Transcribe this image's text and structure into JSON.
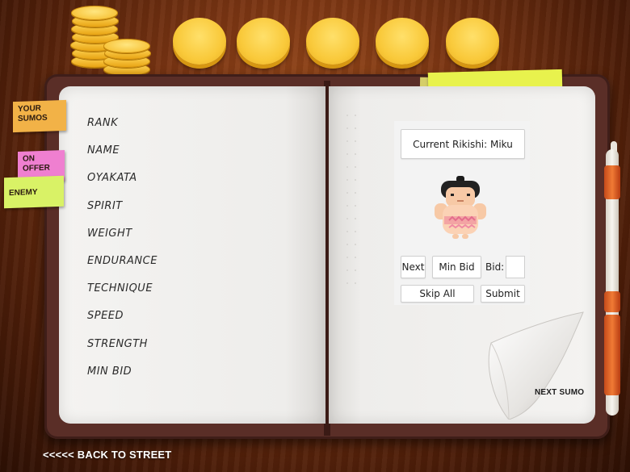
{
  "tabs": {
    "your_sumos": [
      "YOUR",
      "SUMOS"
    ],
    "on_offer": [
      "ON",
      "OFFER"
    ],
    "enemy": "ENEMY"
  },
  "stats": [
    "RANK",
    "NAME",
    "OYAKATA",
    "SPIRIT",
    "WEIGHT",
    "ENDURANCE",
    "TECHNIQUE",
    "SPEED",
    "STRENGTH",
    "MIN BID"
  ],
  "panel": {
    "current": "Current Rikishi: Miku",
    "next": "Next",
    "min_bid": "Min Bid",
    "bid_label": "Bid:",
    "bid_value": "",
    "skip_all": "Skip All",
    "submit": "Submit"
  },
  "next_sumo": "NEXT SUMO",
  "back": "<<<<< BACK TO STREET",
  "icons": {
    "coin_stack": "coin-stack-icon",
    "coins": [
      "coin-icon",
      "coin-icon",
      "coin-icon",
      "coin-icon",
      "coin-icon"
    ],
    "rikishi": "sumo-wrestler-avatar",
    "pen": "pen-icon"
  },
  "colors": {
    "coin": "#f9c93a",
    "tab_your": "#f2b247",
    "tab_offer": "#ef7fd0",
    "tab_enemy": "#d9f266",
    "cover": "#5a2e27"
  }
}
